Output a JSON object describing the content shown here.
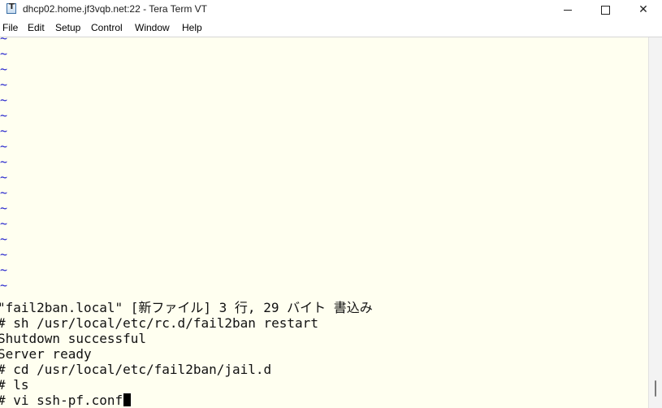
{
  "window": {
    "title": "dhcp02.home.jf3vqb.net:22 - Tera Term VT",
    "app_icon": "teraterm-icon"
  },
  "controls": {
    "minimize_icon": "minimize-icon",
    "maximize_icon": "maximize-icon",
    "close_icon": "close-icon",
    "close_glyph": "✕"
  },
  "menu": {
    "items": [
      "File",
      "Edit",
      "Setup",
      "Control",
      "Window",
      "Help"
    ]
  },
  "terminal": {
    "tilde_char": "~",
    "tilde_count": 17,
    "lines": [
      "\"fail2ban.local\" [新ファイル] 3 行, 29 バイト 書込み",
      "# sh /usr/local/etc/rc.d/fail2ban restart",
      "Shutdown successful",
      "Server ready",
      "# cd /usr/local/etc/fail2ban/jail.d",
      "# ls",
      "# vi ssh-pf.conf"
    ],
    "background_color": "#fffff0",
    "tilde_color": "#2222cc"
  }
}
